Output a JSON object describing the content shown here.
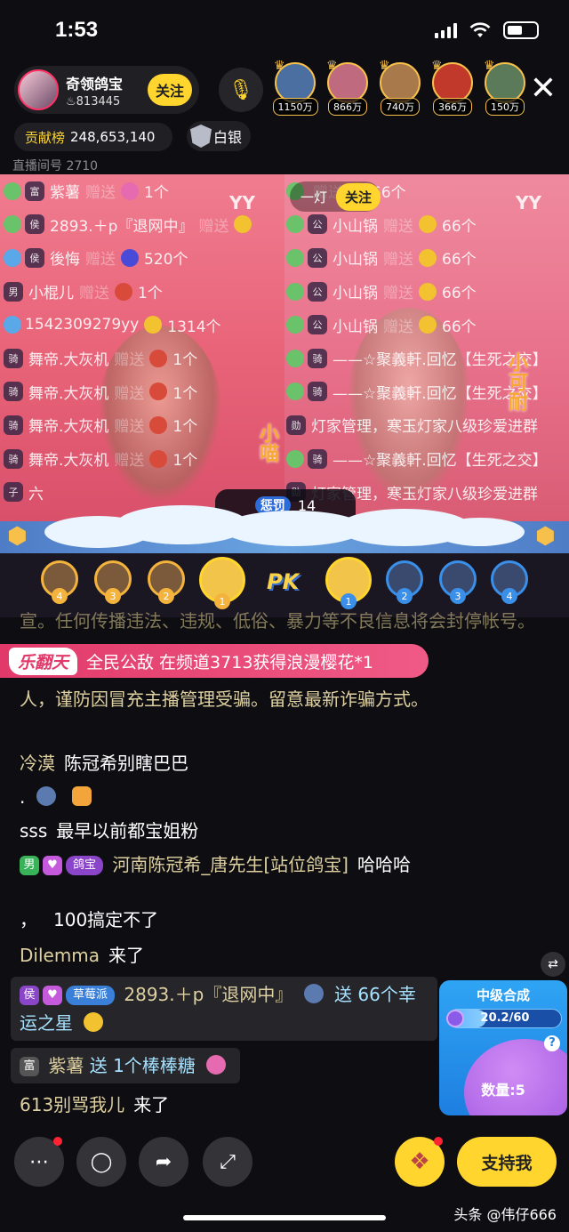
{
  "status_bar": {
    "time": "1:53"
  },
  "host": {
    "name": "奇领鸽宝",
    "fans": "813445",
    "follow_label": "关注"
  },
  "top_viewers": [
    {
      "amount": "1150万",
      "color": "#4a6fa0"
    },
    {
      "amount": "866万",
      "color": "#c06a80"
    },
    {
      "amount": "740万",
      "color": "#a8794a"
    },
    {
      "amount": "366万",
      "color": "#c0392b"
    },
    {
      "amount": "150万",
      "color": "#5a7a5a"
    }
  ],
  "contribution": {
    "label": "贡献榜",
    "value": "248,653,140"
  },
  "rank": {
    "label": "白银"
  },
  "room": {
    "label": "直播间号 2710"
  },
  "pk": {
    "left_chat": [
      {
        "badge": "富",
        "user": "紫薯",
        "send": "赠送",
        "count": "1个",
        "lvl": "#6ac26a",
        "gift": "#e56ab0"
      },
      {
        "badge": "侯",
        "user": "2893.＋p『退网中』",
        "send": "赠送",
        "count": "",
        "lvl": "#6ac26a",
        "gift": "#f2c230"
      },
      {
        "badge": "侯",
        "user": "後悔",
        "send": "赠送",
        "count": "520个",
        "lvl": "#5aa8e8",
        "gift": "#4a4ad8"
      },
      {
        "badge": "男",
        "user": "小棍儿",
        "send": "赠送",
        "count": "1个",
        "lvl": "",
        "gift": "#d84a3a"
      },
      {
        "badge": "",
        "user": "1542309279yy",
        "send": "",
        "count": "1314个",
        "lvl": "#5aa8e8",
        "gift": "#f2c230"
      },
      {
        "badge": "骑",
        "user": "舞帝.大灰机",
        "send": "赠送",
        "count": "1个",
        "lvl": "",
        "gift": "#d84a3a"
      },
      {
        "badge": "骑",
        "user": "舞帝.大灰机",
        "send": "赠送",
        "count": "1个",
        "lvl": "",
        "gift": "#d84a3a"
      },
      {
        "badge": "骑",
        "user": "舞帝.大灰机",
        "send": "赠送",
        "count": "1个",
        "lvl": "",
        "gift": "#d84a3a"
      },
      {
        "badge": "骑",
        "user": "舞帝.大灰机",
        "send": "赠送",
        "count": "1个",
        "lvl": "",
        "gift": "#d84a3a"
      },
      {
        "badge": "子",
        "user": "六",
        "send": "",
        "count": "",
        "lvl": "",
        "gift": ""
      }
    ],
    "right_chat": [
      {
        "badge": "",
        "user": "",
        "send": "赠送",
        "count": "66个",
        "lvl": "#6ac26a",
        "gift": "#f2c230"
      },
      {
        "badge": "公",
        "user": "小山锅",
        "send": "赠送",
        "count": "66个",
        "lvl": "#6ac26a",
        "gift": "#f2c230"
      },
      {
        "badge": "公",
        "user": "小山锅",
        "send": "赠送",
        "count": "66个",
        "lvl": "#6ac26a",
        "gift": "#f2c230"
      },
      {
        "badge": "公",
        "user": "小山锅",
        "send": "赠送",
        "count": "66个",
        "lvl": "#6ac26a",
        "gift": "#f2c230"
      },
      {
        "badge": "公",
        "user": "小山锅",
        "send": "赠送",
        "count": "66个",
        "lvl": "#6ac26a",
        "gift": "#f2c230"
      },
      {
        "badge": "骑",
        "user": "——☆聚義軒.回忆【生死之交】",
        "send": "",
        "count": "",
        "lvl": "#6ac26a",
        "gift": ""
      },
      {
        "badge": "骑",
        "user": "——☆聚義軒.回忆【生死之交】",
        "send": "",
        "count": "",
        "lvl": "#6ac26a",
        "gift": ""
      },
      {
        "badge": "勋",
        "user": "灯家管理，寒玉灯家八级珍爱进群",
        "send": "",
        "count": "",
        "lvl": "",
        "gift": ""
      },
      {
        "badge": "骑",
        "user": "——☆聚義軒.回忆【生死之交】",
        "send": "",
        "count": "",
        "lvl": "#6ac26a",
        "gift": ""
      },
      {
        "badge": "勋",
        "user": "灯家管理，寒玉灯家八级珍爱进群",
        "send": "",
        "count": "",
        "lvl": "",
        "gift": ""
      }
    ],
    "yy_left": "YY",
    "yy_right": "YY",
    "follow_name": "一灯",
    "follow_label": "关注",
    "timer_label": "惩罚",
    "timer_value": "14",
    "left_tag": "小喵",
    "right_tag": "小可耐",
    "logo": "PK",
    "left_players": [
      "4",
      "3",
      "2",
      "1"
    ],
    "right_players": [
      "1",
      "2",
      "3",
      "4"
    ]
  },
  "chat": {
    "notice_hidden": "宣。任何传播违法、违规、低俗、暴力等不良信息将会封停帐号。",
    "banner_tag": "乐翻天",
    "banner_text": "全民公敌  在频道3713获得浪漫樱花*1",
    "notice": "人，谨防因冒充主播管理受骗。留意最新诈骗方式。",
    "messages": [
      {
        "user": "冷漠",
        "text": "陈冠希别瞎巴巴"
      },
      {
        "user": ".",
        "text": ""
      },
      {
        "user": "sss",
        "text": "最早以前都宝姐粉"
      },
      {
        "badge_nan": "男",
        "fans": "鸽宝",
        "user": "河南陈冠希_唐先生[站位鸽宝]",
        "text": "哈哈哈"
      },
      {
        "user": "，",
        "text": "100搞定不了"
      },
      {
        "user": "Dilemma",
        "text": "来了"
      }
    ],
    "gift1": {
      "badge": "侯",
      "fans": "草莓派",
      "user": "2893.＋p『退网中』",
      "text": "送 66个幸运之星"
    },
    "gift2": {
      "badge": "富",
      "user": "紫薯",
      "text": "送 1个棒棒糖"
    },
    "last": {
      "user": "613别骂我儿",
      "text": "来了"
    }
  },
  "widget": {
    "title": "中级合成",
    "progress": "20.2/60",
    "progress_fraction": 0.337,
    "count": "数量:5",
    "help": "?"
  },
  "toolbar": {
    "support_label": "支持我"
  },
  "watermark": "头条 @伟仔666"
}
